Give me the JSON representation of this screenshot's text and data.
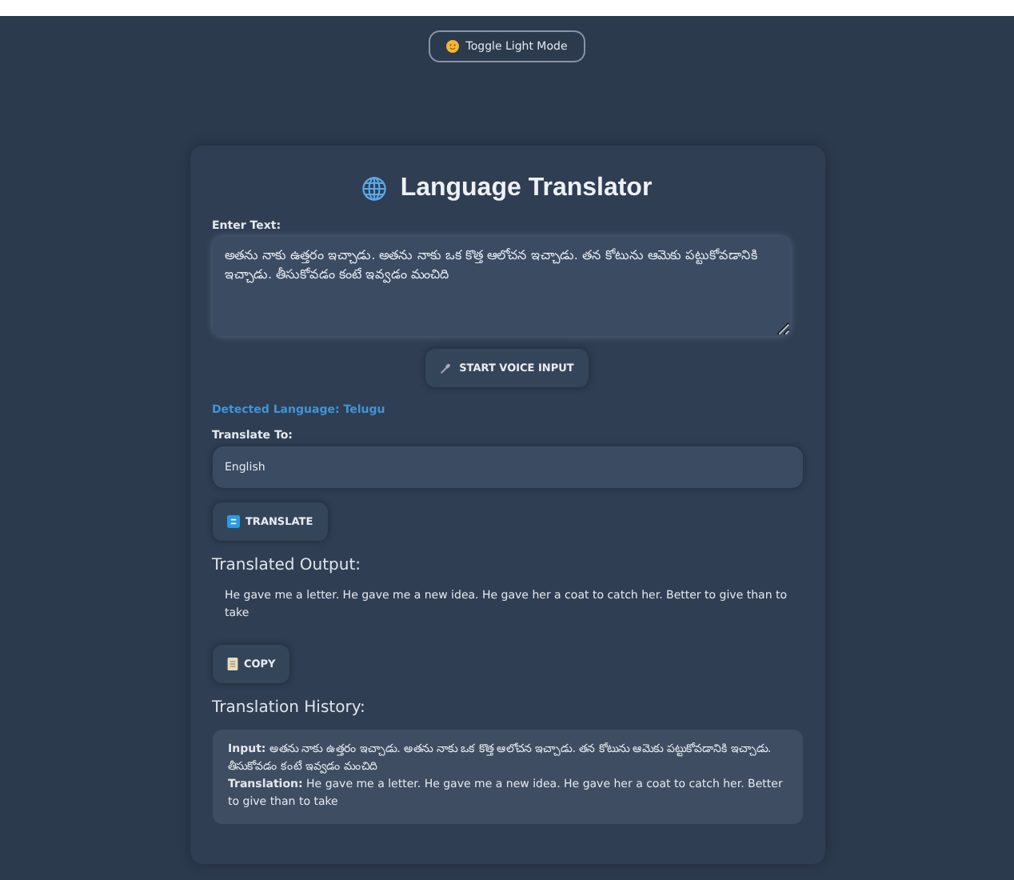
{
  "theme_toggle": {
    "label": "Toggle Light Mode"
  },
  "title": "Language Translator",
  "input": {
    "label": "Enter Text:",
    "value": "అతను నాకు ఉత్తరం ఇచ్చాడు. అతను నాకు ఒక కొత్త ఆలోచన ఇచ్చాడు. తన కోటును ఆమెకు పట్టుకోవడానికి ఇచ్చాడు. తీసుకోవడం కంటే ఇవ్వడం మంచిది"
  },
  "voice_button": {
    "label": "START VOICE INPUT"
  },
  "detected_language": "Detected Language: Telugu",
  "target": {
    "label": "Translate To:",
    "value": "English"
  },
  "translate_button": {
    "label": "TRANSLATE"
  },
  "output": {
    "heading": "Translated Output:",
    "text": "He gave me a letter. He gave me a new idea. He gave her a coat to catch her. Better to give than to take"
  },
  "copy_button": {
    "label": "COPY"
  },
  "history": {
    "heading": "Translation History:",
    "entries": [
      {
        "lines": [
          "**Input:** అతను నాకు ఉత్తరం ఇచ్చాడు. అతను నాకు ఒక కొత్త ఆలోచన ఇచ్చాడు. తన కోటును ఆమెకు పట్టుకోవడానికి ఇచ్చాడు. తీసుకోవడం కంటే ఇవ్వడం మంచిది",
          "**Translation:** He gave me a letter. He gave me a new idea. He gave her a coat to catch her. Better to give than to take"
        ]
      }
    ]
  }
}
